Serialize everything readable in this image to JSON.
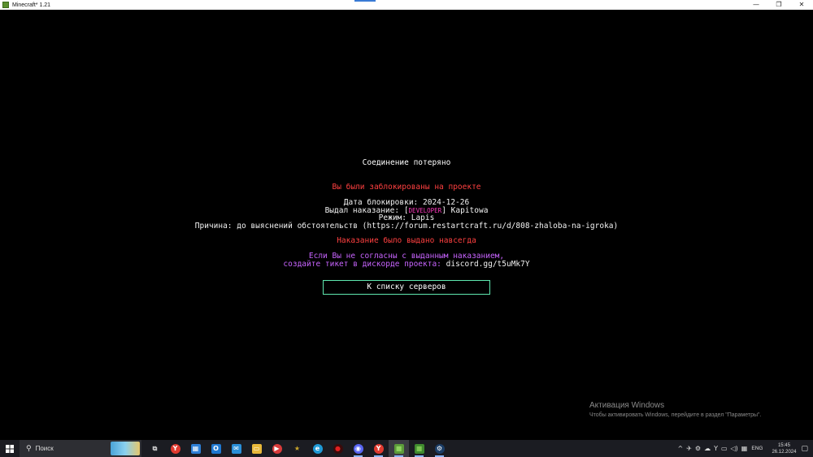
{
  "window": {
    "title": "Minecraft* 1.21",
    "controls": [
      "—",
      "❐",
      "✕"
    ]
  },
  "screen": {
    "heading": "Соединение потеряно",
    "banned_line": "Вы были заблокированы на проекте",
    "ban_date_label": "Дата блокировки:",
    "ban_date_value": "2024-12-26",
    "issued_by_label": "Выдал наказание:",
    "issued_by_rank_open": "[",
    "issued_by_rank": "DEVELOPER",
    "issued_by_rank_close": "]",
    "issued_by_name": "Kapitowa",
    "mode_label": "Режим:",
    "mode_value": "Lapis",
    "reason_line": "Причина: до выяснений обстоятельств (https://forum.restartcraft.ru/d/808-zhaloba-na-igroka)",
    "permanent_line": "Наказание было выдано навсегда",
    "appeal_line1": "Если Вы не согласны с выданным наказанием,",
    "appeal_line2_text": "создайте тикет в дискорде проекта:",
    "appeal_discord": "discord.gg/t5uMk7Y",
    "back_button": "К списку серверов"
  },
  "activation": {
    "title": "Активация Windows",
    "subtitle": "Чтобы активировать Windows, перейдите в раздел \"Параметры\"."
  },
  "taskbar": {
    "search_glyph": "⚲",
    "search_placeholder": "Поиск",
    "apps": [
      {
        "name": "task-view-icon",
        "glyph": "⧉",
        "color": "#1b1c22"
      },
      {
        "name": "yandex-browser-icon",
        "glyph": "Y",
        "color": "#e03a2f"
      },
      {
        "name": "store-icon",
        "glyph": "▦",
        "color": "#2d7fd6"
      },
      {
        "name": "outlook-icon",
        "glyph": "O",
        "color": "#1f78d1"
      },
      {
        "name": "mail-icon",
        "glyph": "✉",
        "color": "#2a8fd8"
      },
      {
        "name": "file-explorer-icon",
        "glyph": "▭",
        "color": "#e8b83a"
      },
      {
        "name": "media-player-icon",
        "glyph": "▶",
        "color": "#d83b3b"
      },
      {
        "name": "star-app-icon",
        "glyph": "★",
        "color": "#caa62b"
      },
      {
        "name": "edge-icon",
        "glyph": "e",
        "color": "#1f9ad6"
      },
      {
        "name": "record-app-icon",
        "glyph": "●",
        "color": "#c71f1f"
      },
      {
        "name": "discord-icon",
        "glyph": "◉",
        "color": "#5865f2"
      },
      {
        "name": "yandex-icon",
        "glyph": "Y",
        "color": "#e03a2f"
      },
      {
        "name": "minecraft-launcher-icon",
        "glyph": "■",
        "color": "#5b9b3a"
      },
      {
        "name": "minecraft-icon",
        "glyph": "■",
        "color": "#3f8a2e"
      },
      {
        "name": "steam-icon",
        "glyph": "⚙",
        "color": "#1b3d66"
      }
    ],
    "tray_glyphs": [
      "^",
      "✈",
      "⚙",
      "☁",
      "Y",
      "▭",
      "◁)",
      "▦"
    ],
    "language": "ENG",
    "time": "15:45",
    "date": "26.12.2024",
    "notification_glyph": "▢"
  }
}
